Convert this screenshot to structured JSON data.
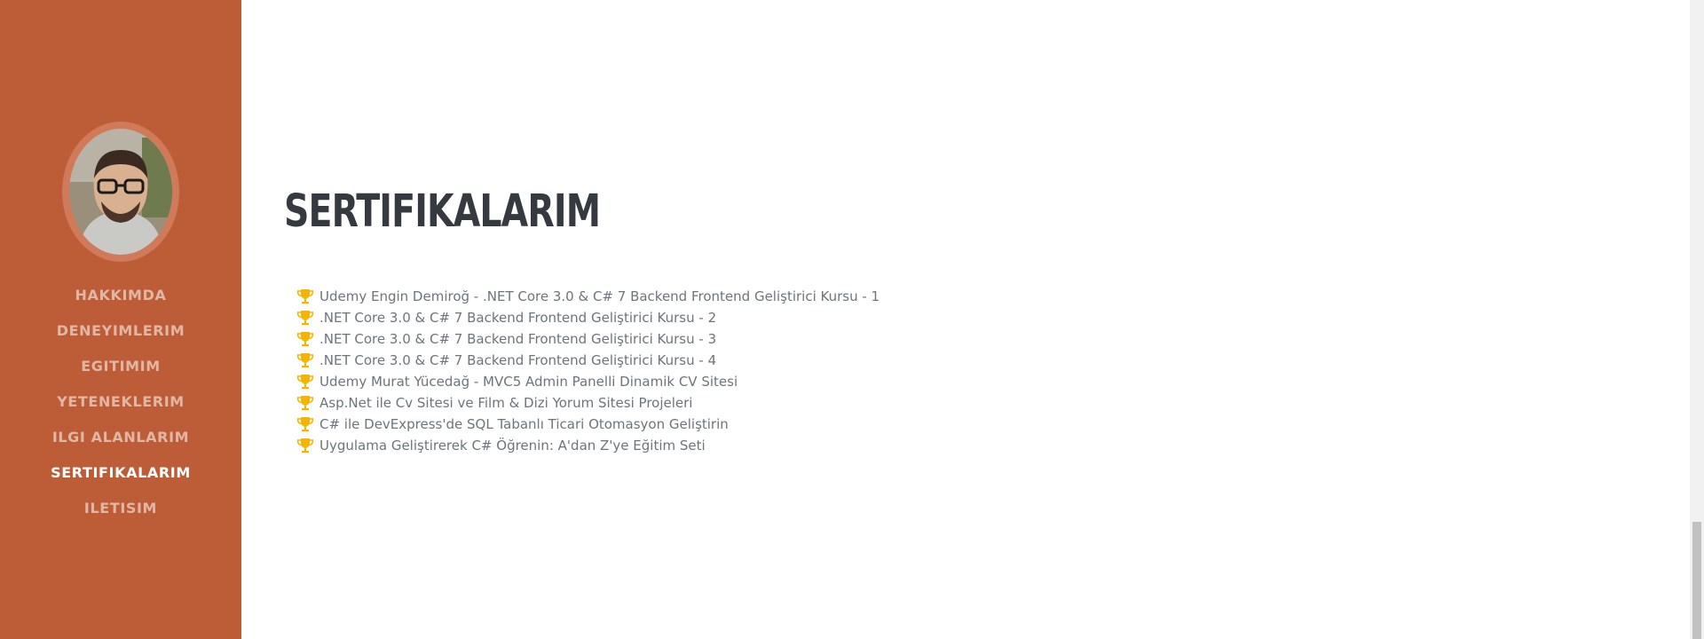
{
  "sidebar": {
    "avatar_alt": "profile photo",
    "nav": [
      {
        "label": "HAKKIMDA",
        "active": false
      },
      {
        "label": "DENEYIMLERIM",
        "active": false
      },
      {
        "label": "EGITIMIM",
        "active": false
      },
      {
        "label": "YETENEKLERIM",
        "active": false
      },
      {
        "label": "ILGI ALANLARIM",
        "active": false
      },
      {
        "label": "SERTIFIKALARIM",
        "active": true
      },
      {
        "label": "ILETISIM",
        "active": false
      }
    ]
  },
  "main": {
    "title": "SERTIFIKALARIM",
    "certificates": [
      "Udemy Engin Demiroğ - .NET Core 3.0 & C# 7 Backend Frontend Geliştirici Kursu - 1",
      ".NET Core 3.0 & C# 7 Backend Frontend Geliştirici Kursu - 2",
      ".NET Core 3.0 & C# 7 Backend Frontend Geliştirici Kursu - 3",
      ".NET Core 3.0 & C# 7 Backend Frontend Geliştirici Kursu - 4",
      "Udemy Murat Yücedağ - MVC5 Admin Panelli Dinamik CV Sitesi",
      "Asp.Net ile Cv Sitesi ve Film & Dizi Yorum Sitesi Projeleri",
      "C# ile DevExpress'de SQL Tabanlı Ticari Otomasyon Geliştirin",
      "Uygulama Geliştirerek C# Öğrenin: A'dan Z'ye Eğitim Seti"
    ],
    "list_icon": "trophy-icon"
  },
  "colors": {
    "sidebar_bg": "#bd5d38",
    "title": "#343a40",
    "text": "#6c757d",
    "trophy": "#f5b400"
  }
}
